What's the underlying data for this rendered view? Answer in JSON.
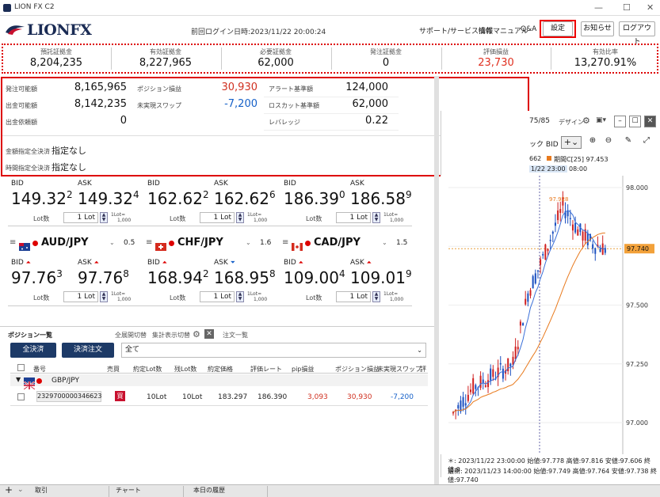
{
  "window": {
    "title": "LION FX C2"
  },
  "header": {
    "logo": "LIONFX",
    "last_login": "前回ログイン日時:2023/11/22 20:00:24",
    "links": [
      "サポート/サービス情報",
      "操作マニュアル",
      "Q&A"
    ],
    "buttons": [
      "設定",
      "お知らせ",
      "ログアウト"
    ]
  },
  "summary": [
    {
      "label": "預託証拠金",
      "value": "8,204,235",
      "color": "#111111"
    },
    {
      "label": "有効証拠金",
      "value": "8,227,965",
      "color": "#111111"
    },
    {
      "label": "必要証拠金",
      "value": "62,000",
      "color": "#111111"
    },
    {
      "label": "発注証拠金",
      "value": "0",
      "color": "#111111"
    },
    {
      "label": "評価損益",
      "value": "23,730",
      "color": "#e03020"
    },
    {
      "label": "有効比率",
      "value": "13,270.91%",
      "color": "#111111"
    }
  ],
  "detail": {
    "rows": [
      {
        "l1": "発注可能額",
        "v1": "8,165,965",
        "l2": "ポジション損益",
        "v2": "30,930",
        "l3": "アラート基準額",
        "v3": "124,000"
      },
      {
        "l1": "出金可能額",
        "v1": "8,142,235",
        "l2": "未実現スワップ",
        "v2": "-7,200",
        "l3": "ロスカット基準額",
        "v3": "62,000"
      },
      {
        "l1": "出金依頼額",
        "v1": "0",
        "l2": "",
        "v2": "",
        "l3": "レバレッジ",
        "v3": "0.22"
      }
    ],
    "settle1_label": "金額指定全決済",
    "settle1_value": "指定なし",
    "settle2_label": "時間指定全決済",
    "settle2_value": "指定なし",
    "set_button": "設定"
  },
  "rates_top": [
    {
      "bid_main": "149.32",
      "bid_sup": "2",
      "ask_main": "149.32",
      "ask_sup": "4",
      "lot": "1"
    },
    {
      "bid_main": "162.62",
      "bid_sup": "2",
      "ask_main": "162.62",
      "ask_sup": "6",
      "lot": "1"
    },
    {
      "bid_main": "186.39",
      "bid_sup": "0",
      "ask_main": "186.58",
      "ask_sup": "9",
      "lot": "1"
    }
  ],
  "rates_bottom": [
    {
      "pair": "AUD/JPY",
      "spread": "0.5",
      "bid_main": "97.76",
      "bid_sup": "3",
      "ask_main": "97.76",
      "ask_sup": "8",
      "lot": "1"
    },
    {
      "pair": "CHF/JPY",
      "spread": "1.6",
      "bid_main": "168.94",
      "bid_sup": "2",
      "ask_main": "168.95",
      "ask_sup": "8",
      "lot": "1"
    },
    {
      "pair": "CAD/JPY",
      "spread": "1.5",
      "bid_main": "109.00",
      "bid_sup": "4",
      "ask_main": "109.01",
      "ask_sup": "9",
      "lot": "1"
    }
  ],
  "labels": {
    "bid": "BID",
    "ask": "ASK",
    "lot": "Lot数",
    "lot_unit": "Lot",
    "lot_note1": "1Lot=",
    "lot_note2": "1,000"
  },
  "positions": {
    "title": "ポジション一覧",
    "toggle1": "全展開切替",
    "toggle2": "集計表示切替",
    "orders_tab": "注文一覧",
    "btn_all": "全決済",
    "btn_settle": "決済注文",
    "filter": "全て",
    "columns": [
      "番号",
      "売買",
      "約定Lot数",
      "残Lot数",
      "約定価格",
      "評価レート",
      "pip損益",
      "ポジション損益",
      "未実現スワップ",
      "評"
    ],
    "group": "GBP/JPY",
    "row": {
      "id": "2329700000346623",
      "side": "買",
      "lot": "10Lot",
      "remain": "10Lot",
      "price": "183.297",
      "rate": "186.390",
      "pip": "3,093",
      "pl": "30,930",
      "swap": "-7,200"
    }
  },
  "chart": {
    "title_frag": "75/85",
    "design": "デザイン",
    "bid_sel": "ック BID",
    "legend1": "662",
    "legend2": "期間C[25] 97.453",
    "time_hdr": "1/22 23:00",
    "time_hdr2": "08:00",
    "yticks": [
      "98.000",
      "97.750",
      "97.500",
      "97.250",
      "97.000"
    ],
    "price_tag": "97.740",
    "peak": "97.928",
    "footer1": "＊: 2023/11/22 23:00:00 始値:97.778 高値:97.816 安値:97.606 終値:9",
    "footer2": "最新: 2023/11/23 14:00:00 始値:97.749 高値:97.764 安値:97.738 終値:97.740"
  },
  "bottom_tabs": [
    "取引",
    "チャート",
    "本日の履歴"
  ]
}
